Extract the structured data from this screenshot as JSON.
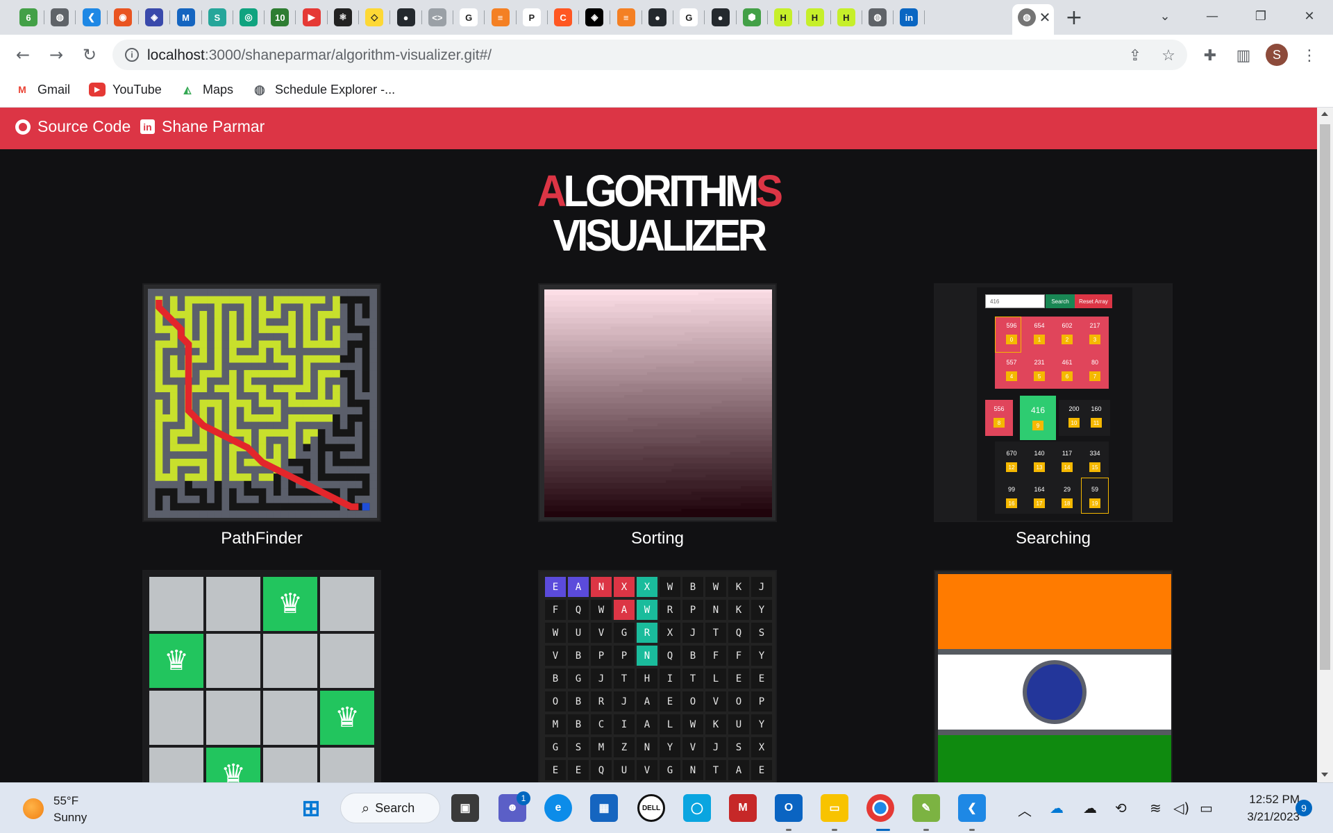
{
  "browser": {
    "tabs_favicons": [
      {
        "icon": "leaf-icon",
        "color": "#43a047",
        "glyph": "6"
      },
      {
        "icon": "globe-icon",
        "color": "#5f6368",
        "glyph": "◍"
      },
      {
        "icon": "vscode-icon",
        "color": "#1e88e5",
        "glyph": "❮"
      },
      {
        "icon": "ubuntu-icon",
        "color": "#e95420",
        "glyph": "◉"
      },
      {
        "icon": "upgrad-icon",
        "color": "#3949ab",
        "glyph": "◈"
      },
      {
        "icon": "mq-icon",
        "color": "#1565c0",
        "glyph": "M"
      },
      {
        "icon": "s-icon",
        "color": "#26a69a",
        "glyph": "S"
      },
      {
        "icon": "chatgpt-icon",
        "color": "#10a37f",
        "glyph": "◎"
      },
      {
        "icon": "ten-icon",
        "color": "#2e7d32",
        "glyph": "10"
      },
      {
        "icon": "youtube-icon",
        "color": "#e53935",
        "glyph": "▶"
      },
      {
        "icon": "react-icon",
        "color": "#222",
        "glyph": "⚛"
      },
      {
        "icon": "snapchat-icon",
        "color": "#fdd835",
        "glyph": "◇"
      },
      {
        "icon": "github-icon",
        "color": "#24292e",
        "glyph": "●"
      },
      {
        "icon": "code-icon",
        "color": "#9aa0a6",
        "glyph": "<>"
      },
      {
        "icon": "google-icon",
        "color": "#fff",
        "glyph": "G"
      },
      {
        "icon": "stackoverflow-icon",
        "color": "#f48024",
        "glyph": "≡"
      },
      {
        "icon": "p-icon",
        "color": "#fff",
        "glyph": "P"
      },
      {
        "icon": "c-icon",
        "color": "#ff5722",
        "glyph": "C"
      },
      {
        "icon": "codepen-icon",
        "color": "#000",
        "glyph": "◈"
      },
      {
        "icon": "stackoverflow-icon",
        "color": "#f48024",
        "glyph": "≡"
      },
      {
        "icon": "github-icon",
        "color": "#24292e",
        "glyph": "●"
      },
      {
        "icon": "google-icon",
        "color": "#fff",
        "glyph": "G"
      },
      {
        "icon": "github-icon",
        "color": "#24292e",
        "glyph": "●"
      },
      {
        "icon": "node-icon",
        "color": "#43a047",
        "glyph": "⬢"
      },
      {
        "icon": "h-icon",
        "color": "#c6ef2a",
        "glyph": "H"
      },
      {
        "icon": "h-icon",
        "color": "#c6ef2a",
        "glyph": "H"
      },
      {
        "icon": "h-icon",
        "color": "#c6ef2a",
        "glyph": "H"
      },
      {
        "icon": "globe-icon",
        "color": "#5f6368",
        "glyph": "◍"
      },
      {
        "icon": "linkedin-icon",
        "color": "#0a66c2",
        "glyph": "in"
      }
    ],
    "url_host": "localhost",
    "url_path": ":3000/shaneparmar/algorithm-visualizer.git#/",
    "profile_initial": "S",
    "bookmarks": [
      {
        "label": "Gmail",
        "icon": "gmail-icon"
      },
      {
        "label": "YouTube",
        "icon": "youtube-icon"
      },
      {
        "label": "Maps",
        "icon": "maps-icon"
      },
      {
        "label": "Schedule Explorer -...",
        "icon": "globe-icon"
      }
    ]
  },
  "navbar": {
    "source_code": "Source Code",
    "author": "Shane Parmar",
    "color": "#dc3545"
  },
  "hero": {
    "line1_first": "A",
    "line1_middle": "LGORITHM",
    "line1_last": "S",
    "line2": "VISUALIZER"
  },
  "cards": {
    "pathfinder": "PathFinder",
    "sorting": "Sorting",
    "searching": "Searching"
  },
  "searching_preview": {
    "input_value": "416",
    "search_label": "Search",
    "reset_label": "Reset Array",
    "values": [
      596,
      654,
      602,
      217,
      557,
      231,
      461,
      80,
      556,
      416,
      200,
      160,
      670,
      140,
      117,
      334,
      99,
      164,
      29,
      59
    ],
    "indices": [
      "0",
      "1",
      "2",
      "3",
      "4",
      "5",
      "6",
      "7",
      "8",
      "9",
      "10",
      "11",
      "12",
      "13",
      "14",
      "15",
      "16",
      "17",
      "18",
      "19"
    ]
  },
  "queens_preview": {
    "queens": [
      [
        0,
        2
      ],
      [
        1,
        0
      ],
      [
        2,
        3
      ],
      [
        3,
        1
      ]
    ],
    "crown_glyph": "♛"
  },
  "wordsearch_preview": {
    "rows": [
      "EANXXWBWKJ",
      "FQWAWRPNKY",
      "WUVGRXJTQS",
      "VBPPNQBFFY",
      "BGJTHITLEE",
      "OBRJAEOVOP",
      "MBCIALWKUY",
      "GSMZNYVJSX",
      "EEQUVGNTAE"
    ],
    "highlights": {
      "0,0": "#5b4bdb",
      "0,1": "#5b4bdb",
      "0,2": "#dc3545",
      "0,3": "#dc3545",
      "1,3": "#dc3545",
      "0,4": "#1abc9c",
      "1,4": "#1abc9c",
      "2,4": "#1abc9c",
      "3,4": "#1abc9c"
    }
  },
  "taskbar": {
    "temperature": "55°F",
    "weather": "Sunny",
    "search_label": "Search",
    "time": "12:52 PM",
    "date": "3/21/2023",
    "notifications": "9",
    "teams_badge": "1"
  }
}
